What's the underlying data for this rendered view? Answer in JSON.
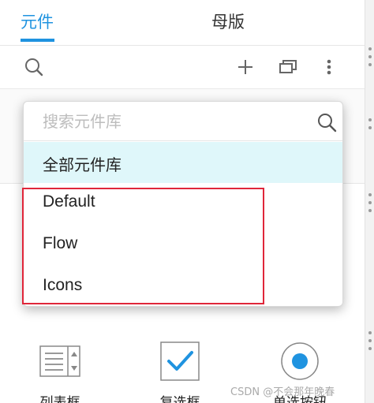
{
  "tabs": [
    {
      "label": "元件",
      "active": true
    },
    {
      "label": "母版",
      "active": false
    }
  ],
  "toolbar": {
    "icons": [
      "search-icon",
      "add-icon",
      "copy-icon",
      "more-icon"
    ]
  },
  "dropdown": {
    "search_placeholder": "搜索元件库",
    "all_libraries": "全部元件库",
    "items": [
      "Default",
      "Flow",
      "Icons"
    ]
  },
  "widgets": [
    {
      "label": "列表框",
      "icon": "listbox-icon"
    },
    {
      "label": "复选框",
      "icon": "checkbox-icon"
    },
    {
      "label": "单选按钮",
      "icon": "radio-icon"
    }
  ],
  "watermark": "CSDN @不会那年晚春",
  "colors": {
    "accent": "#1f93e0",
    "highlight_row": "#dff7fa",
    "annotation_red": "#e0263a"
  }
}
